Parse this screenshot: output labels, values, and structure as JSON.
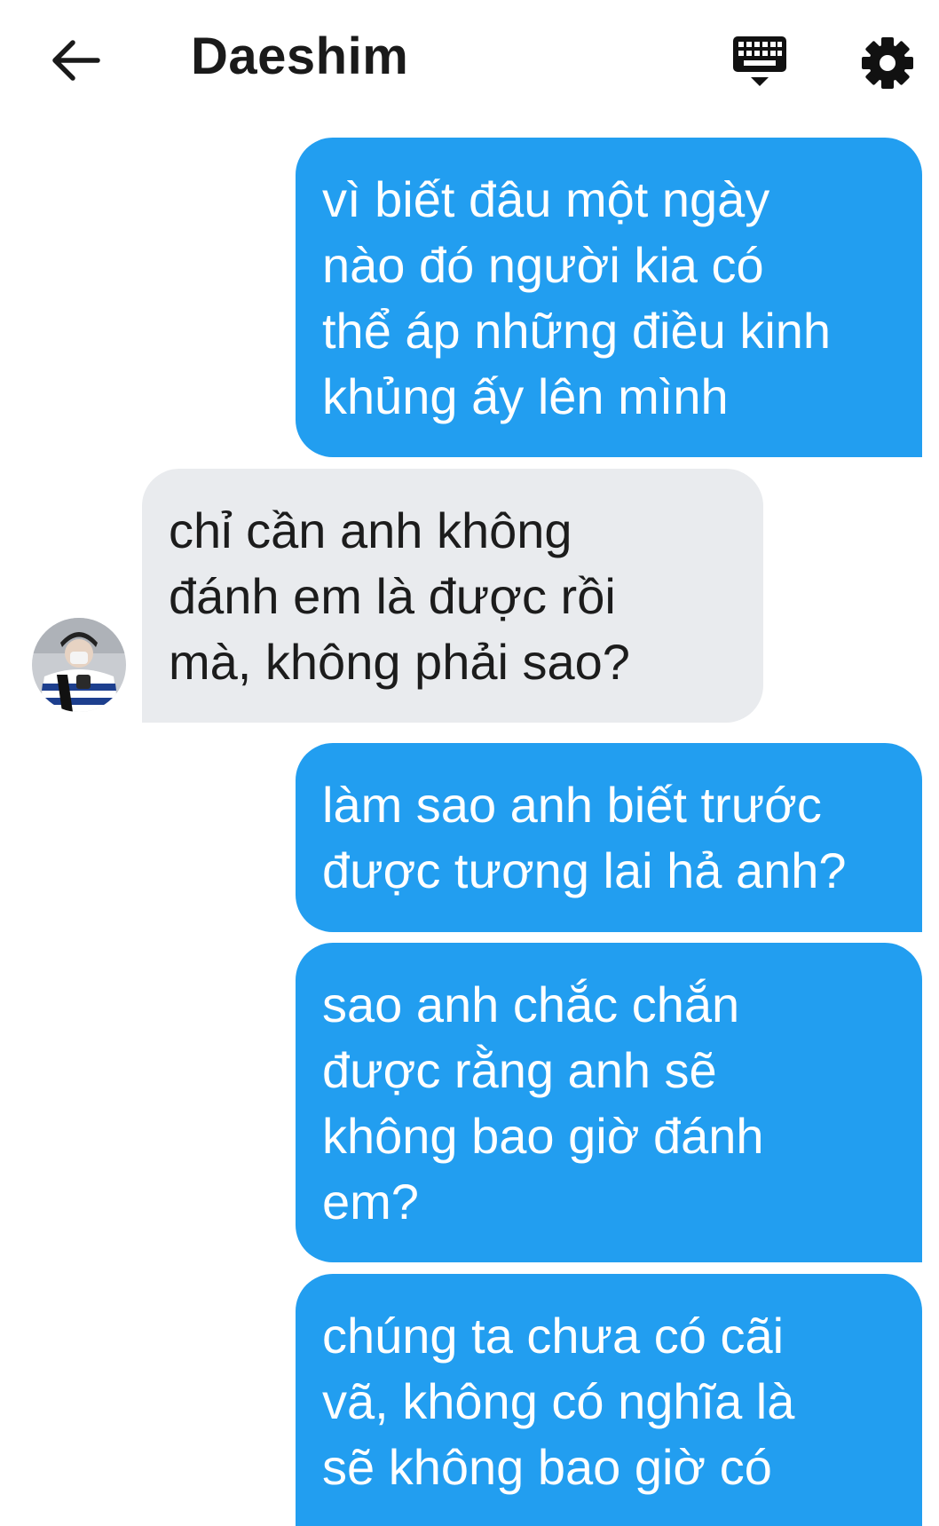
{
  "header": {
    "title": "Daeshim",
    "back_icon": "arrow-left-icon",
    "keyboard_icon": "keyboard-icon",
    "settings_icon": "gear-icon"
  },
  "colors": {
    "sent_bubble": "#229ef0",
    "received_bubble": "#e9ebee"
  },
  "messages": [
    {
      "sender": "me",
      "lines": [
        "vì biết đâu một ngày",
        "nào đó người kia có",
        "thể áp những điều kinh",
        "khủng ấy lên mình"
      ]
    },
    {
      "sender": "Daeshim",
      "lines": [
        "chỉ cần anh không",
        "đánh em là được rồi",
        "mà, không phải sao?"
      ]
    },
    {
      "sender": "me",
      "lines": [
        "làm sao anh biết trước",
        "được tương lai hả anh?"
      ]
    },
    {
      "sender": "me",
      "lines": [
        "sao anh chắc chắn",
        "được rằng anh sẽ",
        "không bao giờ đánh",
        "em?"
      ]
    },
    {
      "sender": "me",
      "lines": [
        "chúng ta chưa có cãi",
        "vã, không có nghĩa là",
        "sẽ không bao giờ có"
      ]
    }
  ]
}
